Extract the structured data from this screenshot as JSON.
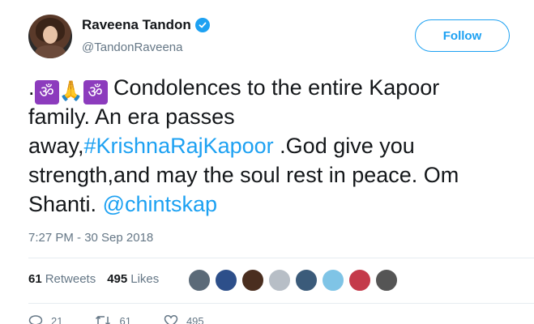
{
  "user": {
    "display_name": "Raveena Tandon",
    "handle": "@TandonRaveena",
    "verified": true,
    "avatar_icon": "avatar-photo"
  },
  "follow_label": "Follow",
  "tweet": {
    "line1_prefix": ".",
    "om_glyph": "ॐ",
    "pray_glyph": "🙏",
    "line1_suffix": " Condolences to the entire Kapoor",
    "line2": "family. An era passes",
    "line3_prefix": "away,",
    "hashtag": "#KrishnaRajKapoor",
    "line3_suffix": " .God give you",
    "line4": "strength,and may the soul rest in peace.  Om",
    "line5_prefix": "Shanti. ",
    "mention": "@chintskap"
  },
  "timestamp": "7:27 PM - 30 Sep 2018",
  "stats": {
    "retweets_count": "61",
    "retweets_label": "Retweets",
    "likes_count": "495",
    "likes_label": "Likes"
  },
  "likers": [
    {
      "icon": "liker-avatar",
      "color": "#5b6a78"
    },
    {
      "icon": "liker-avatar",
      "color": "#2d4f8a"
    },
    {
      "icon": "liker-avatar",
      "color": "#4a2e1f"
    },
    {
      "icon": "liker-avatar",
      "color": "#b7bec6"
    },
    {
      "icon": "liker-avatar",
      "color": "#3b5b7a"
    },
    {
      "icon": "liker-avatar",
      "color": "#7fc4e6"
    },
    {
      "icon": "liker-avatar",
      "color": "#c43a4a"
    },
    {
      "icon": "liker-avatar",
      "color": "#555555"
    }
  ],
  "actions": {
    "reply_count": "21",
    "retweet_count": "61",
    "like_count": "495"
  },
  "colors": {
    "accent": "#1da1f2",
    "secondary_text": "#657786",
    "primary_text": "#14171a"
  }
}
